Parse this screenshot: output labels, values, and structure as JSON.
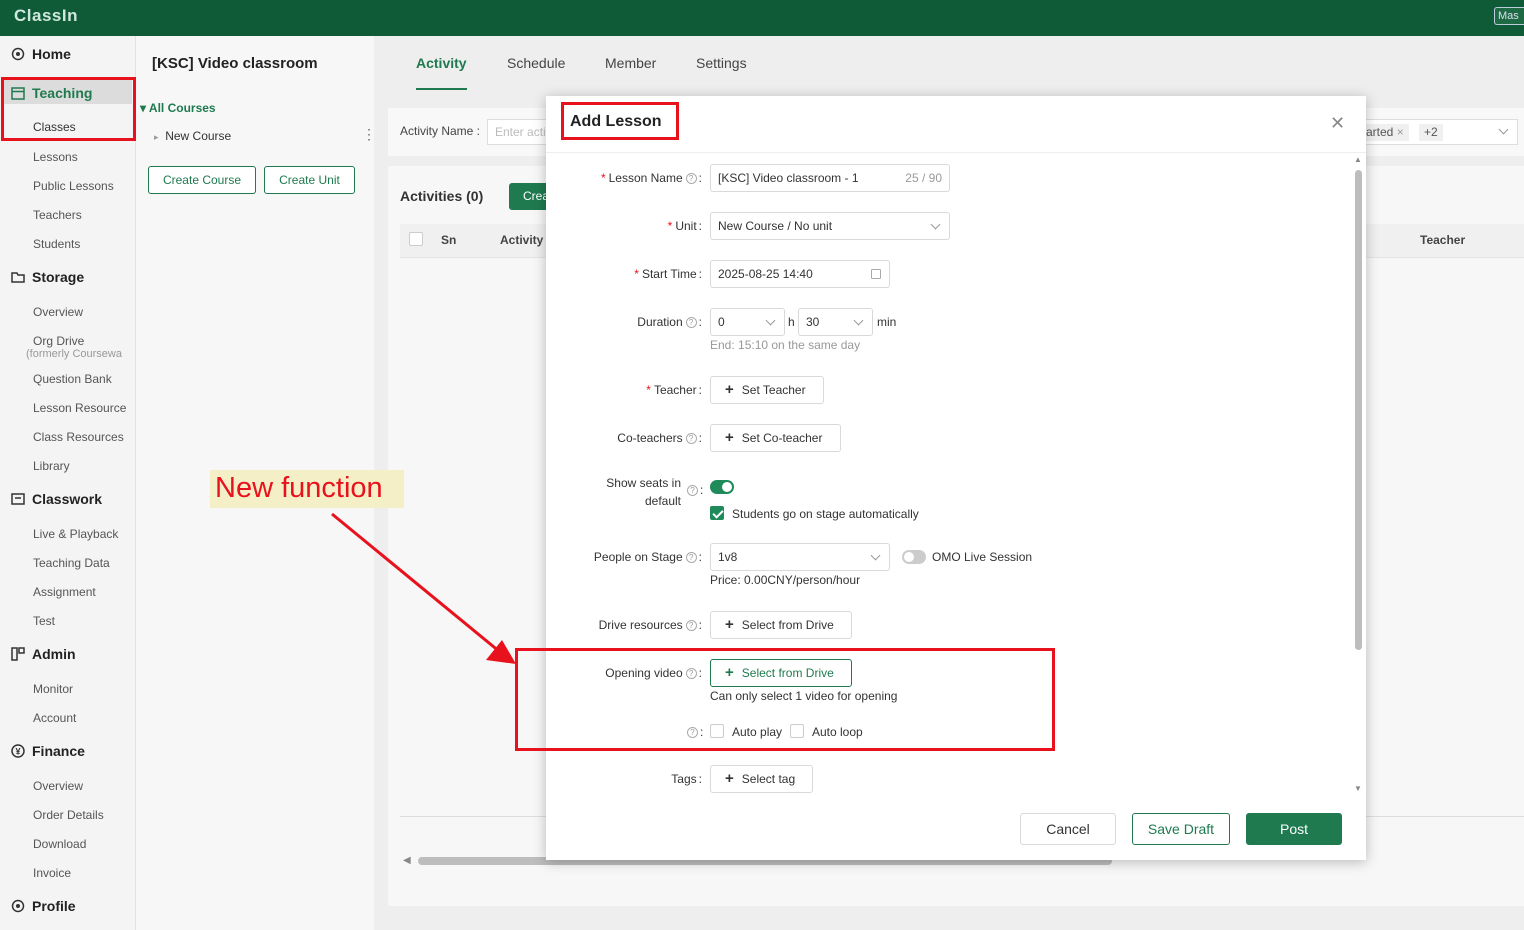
{
  "app": {
    "logo": "ClassIn",
    "user_chip": "Mas"
  },
  "sidebar": {
    "sections": {
      "home": "Home",
      "teaching": "Teaching",
      "storage": "Storage",
      "classwork": "Classwork",
      "admin": "Admin",
      "finance": "Finance",
      "profile": "Profile"
    },
    "teaching_items": [
      "Classes",
      "Lessons",
      "Public Lessons",
      "Teachers",
      "Students"
    ],
    "storage_items": [
      "Overview",
      "Org Drive",
      "(formerly Coursewa",
      "Question Bank",
      "Lesson Resource",
      "Class Resources",
      "Library"
    ],
    "classwork_items": [
      "Live & Playback",
      "Teaching Data",
      "Assignment",
      "Test"
    ],
    "admin_items": [
      "Monitor",
      "Account"
    ],
    "finance_items": [
      "Overview",
      "Order Details",
      "Download",
      "Invoice"
    ]
  },
  "class_panel": {
    "title": "[KSC] Video classroom",
    "all_courses": "All Courses",
    "course": "New Course",
    "create_course": "Create Course",
    "create_unit": "Create Unit"
  },
  "tabs": [
    "Activity",
    "Schedule",
    "Member",
    "Settings"
  ],
  "filter": {
    "activity_name_label": "Activity Name :",
    "activity_name_placeholder": "Enter acti",
    "status_partial": "arted",
    "status_more": "+2"
  },
  "activities": {
    "title": "Activities (0)",
    "create": "Crea",
    "columns": {
      "sn": "Sn",
      "activity": "Activity",
      "teacher": "Teacher"
    }
  },
  "modal": {
    "title": "Add Lesson",
    "lesson_name_label": "Lesson Name",
    "lesson_name_value": "[KSC] Video classroom - 1",
    "lesson_name_counter": "25 / 90",
    "unit_label": "Unit",
    "unit_value": "New Course / No unit",
    "start_time_label": "Start Time",
    "start_time_value": "2025-08-25 14:40",
    "duration_label": "Duration",
    "duration_hours": "0",
    "duration_h_unit": "h",
    "duration_minutes": "30",
    "duration_min_unit": "min",
    "duration_end_hint": "End: 15:10 on the same day",
    "teacher_label": "Teacher",
    "set_teacher": "Set Teacher",
    "coteachers_label": "Co-teachers",
    "set_coteacher": "Set Co-teacher",
    "show_seats_label_line1": "Show seats in",
    "show_seats_label_line2": "default",
    "show_seats_on": true,
    "students_on_stage": "Students go on stage automatically",
    "people_on_stage_label": "People on Stage",
    "people_on_stage_value": "1v8",
    "omo_live_session": "OMO Live Session",
    "price": "Price: 0.00CNY/person/hour",
    "drive_resources_label": "Drive resources",
    "select_from_drive": "Select from Drive",
    "opening_video_label": "Opening video",
    "opening_video_select": "Select from Drive",
    "opening_video_note": "Can only select 1 video for opening",
    "auto_play": "Auto play",
    "auto_loop": "Auto loop",
    "tags_label": "Tags",
    "select_tag": "Select tag",
    "cancel": "Cancel",
    "save_draft": "Save Draft",
    "post": "Post"
  },
  "annotation": {
    "label": "New function"
  },
  "colors": {
    "brand_green": "#1f7a4f",
    "topbar": "#0f5b37",
    "annotation_red": "#e8121c"
  }
}
